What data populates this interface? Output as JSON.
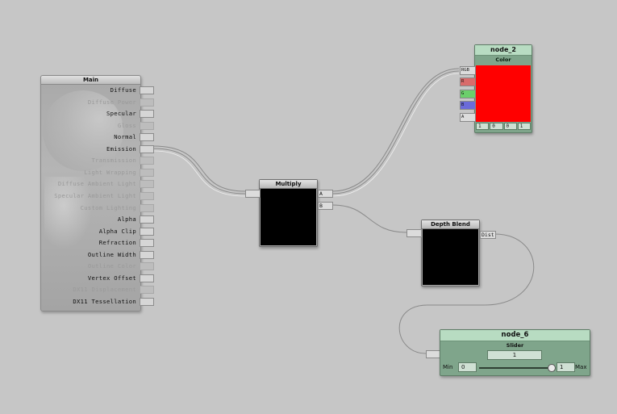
{
  "main_node": {
    "title": "Main",
    "ports": [
      {
        "label": "Diffuse",
        "enabled": true
      },
      {
        "label": "Diffuse Power",
        "enabled": false
      },
      {
        "label": "Specular",
        "enabled": true
      },
      {
        "label": "Gloss",
        "enabled": false
      },
      {
        "label": "Normal",
        "enabled": true
      },
      {
        "label": "Emission",
        "enabled": true
      },
      {
        "label": "Transmission",
        "enabled": false
      },
      {
        "label": "Light Wrapping",
        "enabled": false
      },
      {
        "label": "Diffuse Ambient Light",
        "enabled": false
      },
      {
        "label": "Specular Ambient Light",
        "enabled": false
      },
      {
        "label": "Custom Lighting",
        "enabled": false
      },
      {
        "label": "Alpha",
        "enabled": true
      },
      {
        "label": "Alpha Clip",
        "enabled": true
      },
      {
        "label": "Refraction",
        "enabled": true
      },
      {
        "label": "Outline Width",
        "enabled": true
      },
      {
        "label": "Outline Color",
        "enabled": false
      },
      {
        "label": "Vertex Offset",
        "enabled": true
      },
      {
        "label": "DX11 Displacement",
        "enabled": false
      },
      {
        "label": "DX11 Tessellation",
        "enabled": true
      }
    ]
  },
  "multiply_node": {
    "title": "Multiply",
    "outputs": [
      "A",
      "B"
    ]
  },
  "depth_blend_node": {
    "title": "Depth Blend",
    "output": "Dist"
  },
  "node_2": {
    "name": "node_2",
    "type": "Color",
    "channels": [
      "RGB",
      "R",
      "G",
      "B",
      "A"
    ],
    "channel_colors": [
      "#dcdcdc",
      "#d96b6b",
      "#6bcf6b",
      "#6b6bd9",
      "#dcdcdc"
    ],
    "color": "#ff0000",
    "values": [
      "1",
      "0",
      "0",
      "1"
    ]
  },
  "node_6": {
    "name": "node_6",
    "type": "Slider",
    "value": "1",
    "min_label": "Min",
    "min": "0",
    "max_label": "Max",
    "max": "1",
    "slider_fraction": 1.0
  }
}
